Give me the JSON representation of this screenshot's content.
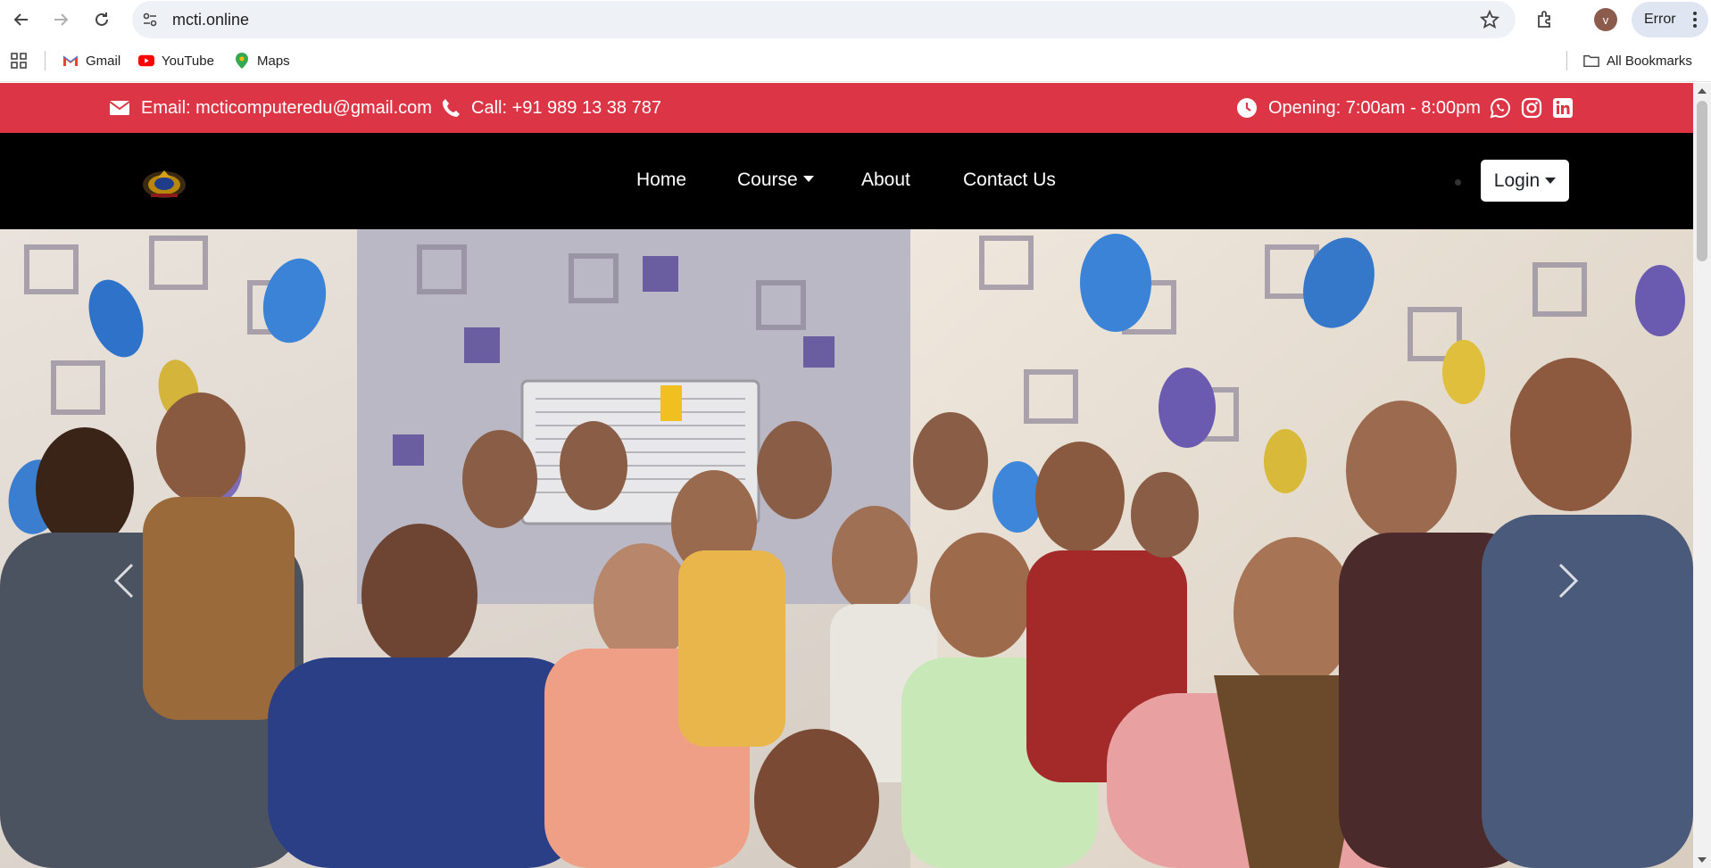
{
  "browser": {
    "url": "mcti.online",
    "profile_initial": "v",
    "status_label": "Error",
    "bookmarks": [
      {
        "label": "Gmail",
        "icon": "gmail-icon"
      },
      {
        "label": "YouTube",
        "icon": "youtube-icon"
      },
      {
        "label": "Maps",
        "icon": "maps-icon"
      }
    ],
    "all_bookmarks_label": "All Bookmarks"
  },
  "topbar": {
    "email": "Email: mcticomputeredu@gmail.com",
    "phone": "Call: +91 989 13 38 787",
    "hours": "Opening: 7:00am - 8:00pm",
    "socials": [
      "whatsapp-icon",
      "instagram-icon",
      "linkedin-icon"
    ],
    "bg_color": "#dc3545"
  },
  "navbar": {
    "links": [
      "Home",
      "Course",
      "About",
      "Contact Us"
    ],
    "login_label": "Login",
    "bg_color": "#000000"
  },
  "hero": {
    "image_alt": "Group photo of students in a classroom"
  }
}
